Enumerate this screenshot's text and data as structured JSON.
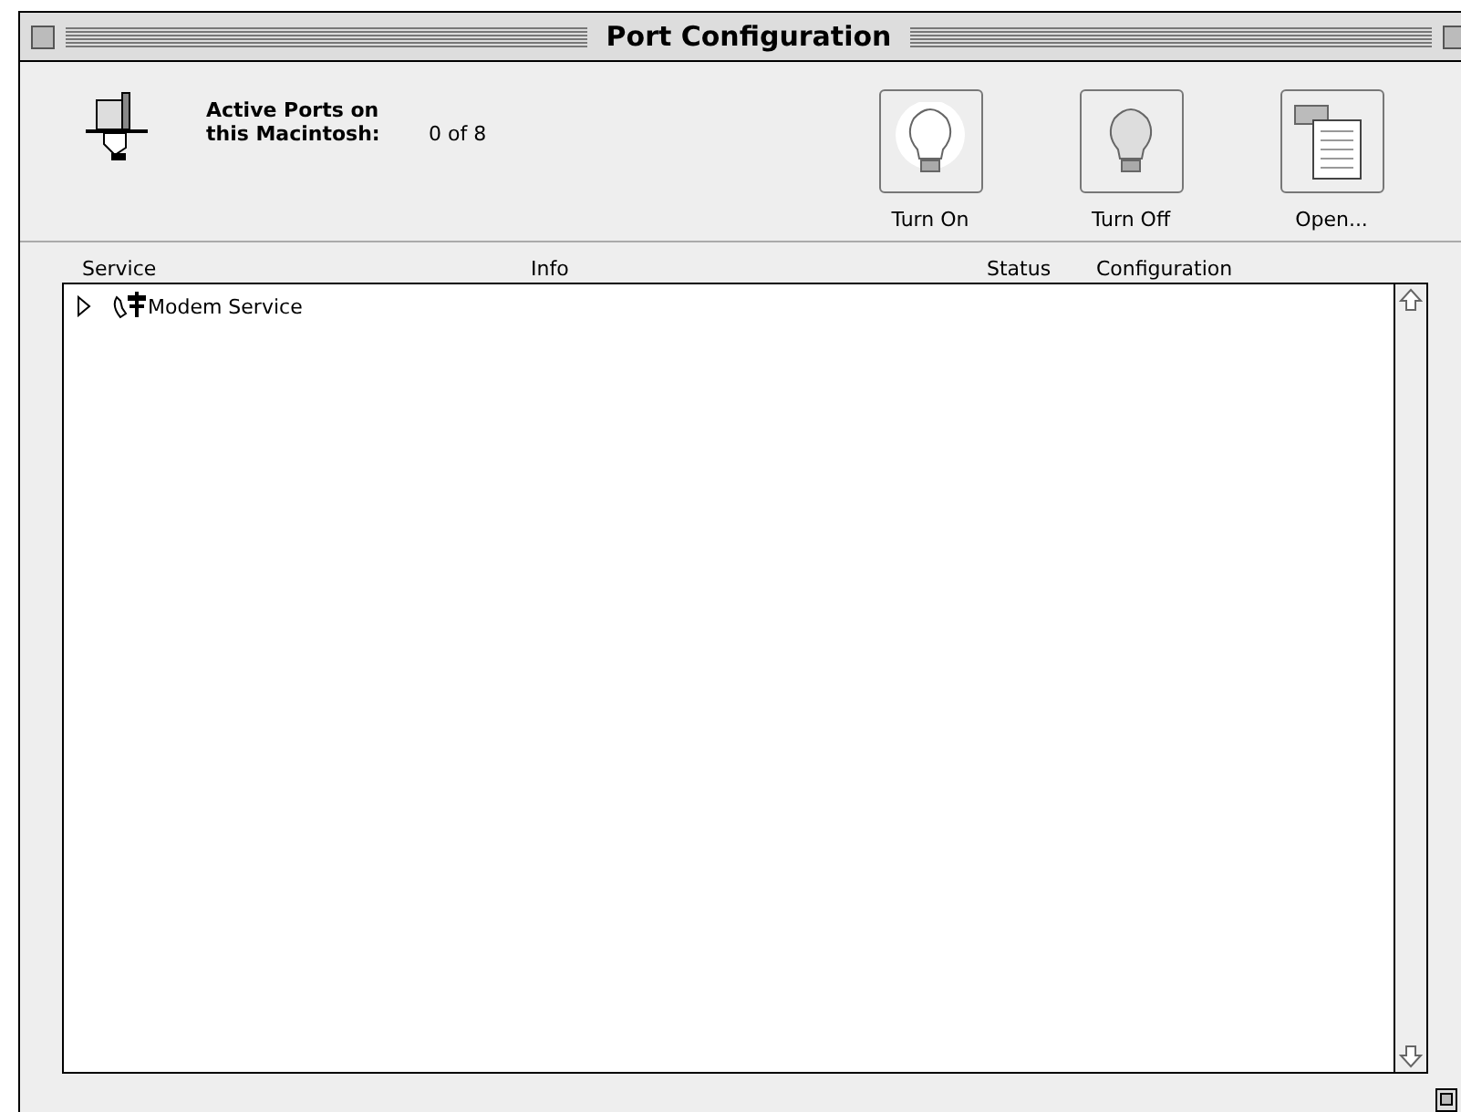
{
  "window": {
    "title": "Port Configuration"
  },
  "header": {
    "label": "Active Ports on this Macintosh:",
    "count": "0 of 8"
  },
  "buttons": [
    {
      "kind": "on",
      "label": "Turn On"
    },
    {
      "kind": "off",
      "label": "Turn Off"
    },
    {
      "kind": "open",
      "label": "Open..."
    }
  ],
  "columns": [
    "Service",
    "Info",
    "Status",
    "Configuration"
  ],
  "rows": [
    {
      "name": "Modem Service",
      "expanded": false
    }
  ]
}
